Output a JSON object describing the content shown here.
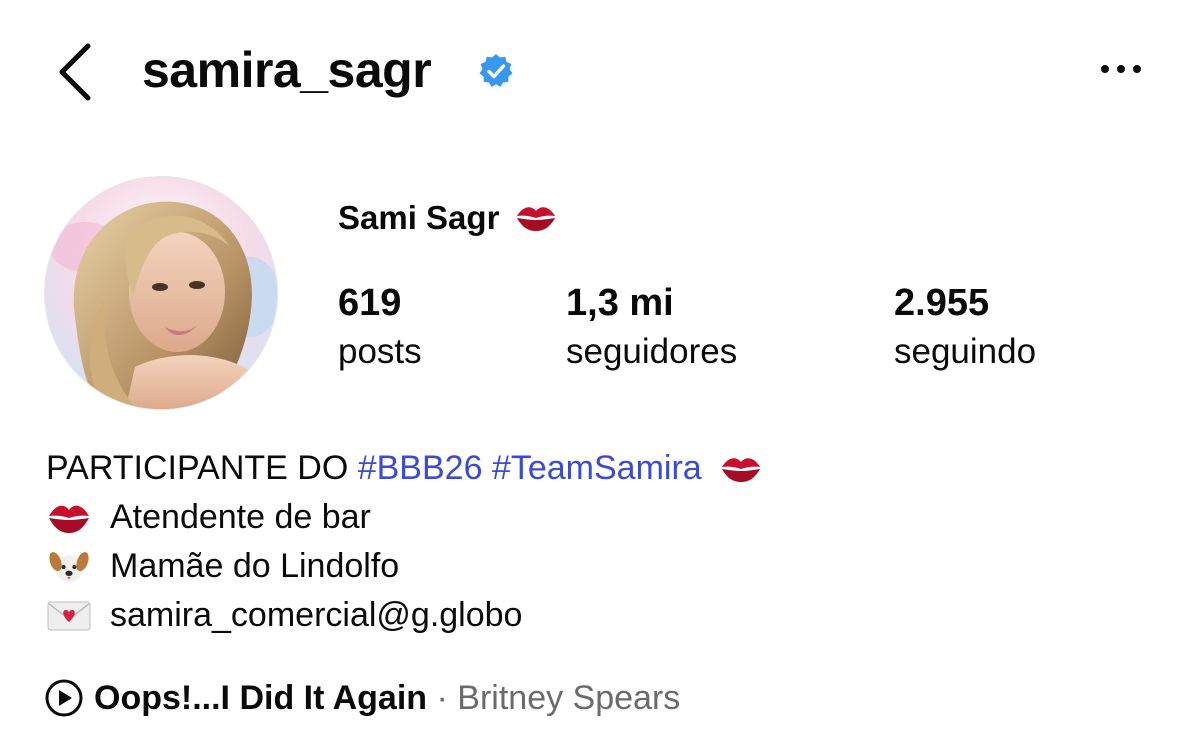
{
  "header": {
    "username": "samira_sagr",
    "verified_icon": "verified-badge-icon",
    "back_icon": "chevron-left-icon",
    "more_icon": "more-horizontal-icon"
  },
  "profile": {
    "display_name": "Sami Sagr",
    "display_name_emoji": "kiss-mark-icon",
    "avatar": "profile-photo"
  },
  "stats": [
    {
      "value": "619",
      "label": "posts"
    },
    {
      "value": "1,3 mi",
      "label": "seguidores"
    },
    {
      "value": "2.955",
      "label": "seguindo"
    }
  ],
  "bio": {
    "line1_prefix": "PARTICIPANTE DO ",
    "line1_hashtag1": "#BBB26",
    "line1_hashtag2": "#TeamSamira",
    "line2": "Atendente de bar",
    "line3": "Mamãe do Lindolfo",
    "line4": "samira_comercial@g.globo"
  },
  "music": {
    "song": "Oops!...I Did It Again",
    "separator": " · ",
    "artist": "Britney Spears",
    "icon": "play-circle-icon"
  },
  "colors": {
    "hashtag": "#3b4bd6",
    "verified": "#3897f0",
    "kiss": "#c8102e",
    "secondary_text": "#6b6b6b"
  }
}
